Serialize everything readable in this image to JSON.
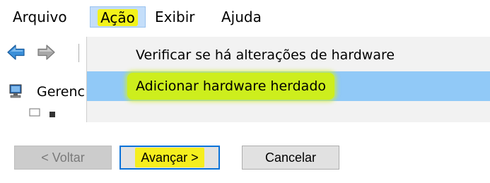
{
  "menubar": {
    "items": [
      {
        "label": "Arquivo"
      },
      {
        "label": "Ação"
      },
      {
        "label": "Exibir"
      },
      {
        "label": "Ajuda"
      }
    ]
  },
  "tree": {
    "root_label": "Gerenc"
  },
  "action_menu": {
    "items": [
      {
        "label": "Verificar se há alterações de hardware"
      },
      {
        "label": "Adicionar hardware herdado"
      }
    ]
  },
  "wizard": {
    "back_label": "< Voltar",
    "next_label": "Avançar >",
    "cancel_label": "Cancelar"
  },
  "colors": {
    "menu_open_bg": "#c4defa",
    "dropdown_bg": "#f2f2f2",
    "dropdown_hover": "#91c9f7",
    "highlighter_yellow": "#f2f21a",
    "default_button_border": "#0a72d9"
  },
  "icons": [
    "back-arrow-icon",
    "forward-arrow-icon",
    "computer-icon"
  ]
}
